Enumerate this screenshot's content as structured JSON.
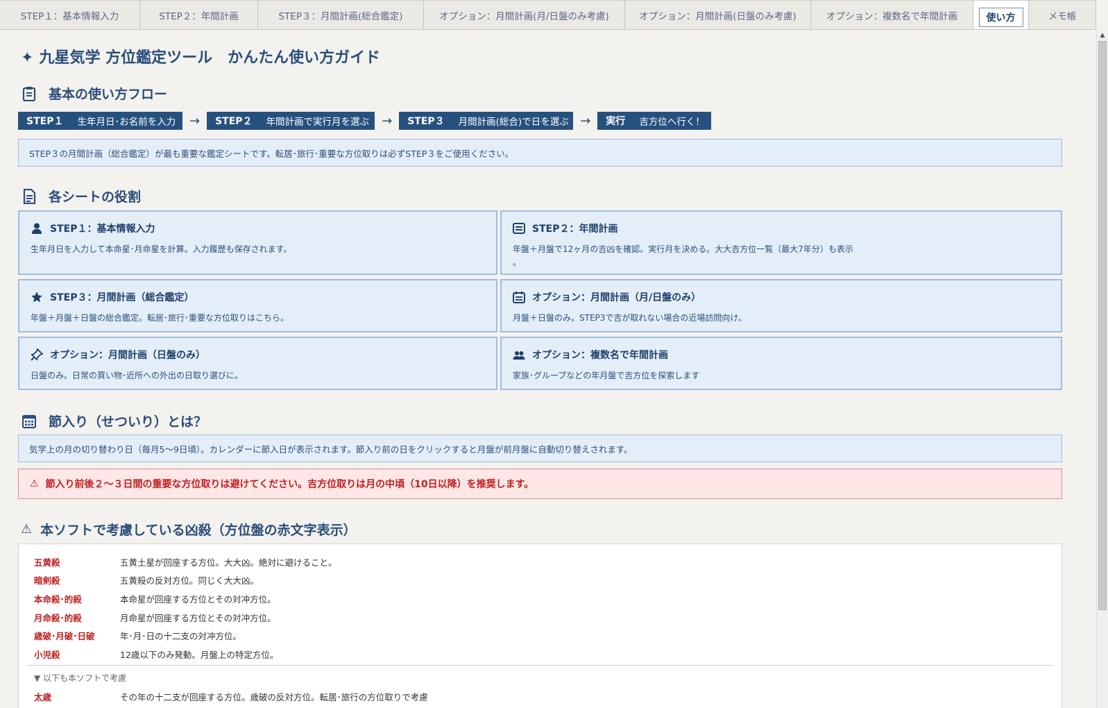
{
  "tabs": [
    {
      "label": "STEP１：基本情報入力",
      "active": false
    },
    {
      "label": "STEP２：年間計画",
      "active": false
    },
    {
      "label": "STEP３：月間計画(総合鑑定)",
      "active": false
    },
    {
      "label": "オプション：月間計画(月/日盤のみ考慮)",
      "active": false
    },
    {
      "label": "オプション：月間計画(日盤のみ考慮)",
      "active": false
    },
    {
      "label": "オプション：複数名で年間計画",
      "active": false
    },
    {
      "label": "使い方",
      "active": true
    },
    {
      "label": "メモ帳",
      "active": false
    }
  ],
  "page": {
    "title_icon": "✦",
    "title": "九星気学 方位鑑定ツール　かんたん使い方ガイド"
  },
  "flow_section": {
    "title": "基本の使い方フロー",
    "steps": [
      {
        "tag": "STEP１",
        "text": "生年月日･お名前を入力"
      },
      {
        "tag": "STEP２",
        "text": "年間計画で実行月を選ぶ"
      },
      {
        "tag": "STEP３",
        "text": "月間計画(総合)で日を選ぶ"
      },
      {
        "tag": "実行",
        "text": "吉方位へ行く！"
      }
    ],
    "arrow": "→",
    "note": "STEP３の月間計画（総合鑑定）が最も重要な鑑定シートです。転居･旅行･重要な方位取りは必ずSTEP３をご使用ください。"
  },
  "sheets_section": {
    "title": "各シートの役割",
    "cards": [
      {
        "icon": "user-icon",
        "title": "STEP１：基本情報入力",
        "desc": "生年月日を入力して本命星･月命星を計算。入力履歴も保存されます。"
      },
      {
        "icon": "list-icon",
        "title": "STEP２：年間計画",
        "desc": "年盤＋月盤で12ヶ月の吉凶を確認。実行月を決める。大大吉方位一覧（最大7年分）も表示\n。"
      },
      {
        "icon": "star-icon",
        "title": "STEP３：月間計画（総合鑑定）",
        "desc": "年盤＋月盤＋日盤の総合鑑定。転居･旅行･重要な方位取りはこちら。"
      },
      {
        "icon": "calendar-icon",
        "title": "オプション：月間計画（月/日盤のみ）",
        "desc": "月盤＋日盤のみ。STEP3で吉が取れない場合の近場訪問向け。"
      },
      {
        "icon": "pin-icon",
        "title": "オプション：月間計画（日盤のみ）",
        "desc": "日盤のみ。日常の買い物･近所への外出の日取り選びに。"
      },
      {
        "icon": "group-icon",
        "title": "オプション：複数名で年間計画",
        "desc": "家族･グループなどの年月盤で吉方位を探索します"
      }
    ]
  },
  "setsuiri_section": {
    "title": "節入り（せついり）とは？",
    "note": "気学上の月の切り替わり日（毎月5～9日頃）。カレンダーに節入日が表示されます。節入り前の日をクリックすると月盤が前月盤に自動切り替えされます。",
    "warning_icon": "⚠",
    "warning": "節入り前後２～３日間の重要な方位取りは避けてください。吉方位取りは月の中頃（10日以降）を推奨します。"
  },
  "kyousatsu_section": {
    "title_icon": "⚠",
    "title": "本ソフトで考慮している凶殺（方位盤の赤文字表示）",
    "items": [
      {
        "name": "五黄殺",
        "desc": "五黄土星が回座する方位。大大凶。絶対に避けること。"
      },
      {
        "name": "暗剣殺",
        "desc": "五黄殺の反対方位。同じく大大凶。"
      },
      {
        "name": "本命殺･的殺",
        "desc": "本命星が回座する方位とその対冲方位。"
      },
      {
        "name": "月命殺･的殺",
        "desc": "月命星が回座する方位とその対冲方位。"
      },
      {
        "name": "歳破･月破･日破",
        "desc": "年･月･日の十二支の対冲方位。"
      },
      {
        "name": "小児殺",
        "desc": "12歳以下のみ発動。月盤上の特定方位。"
      }
    ],
    "more_label": "▼ 以下も本ソフトで考慮",
    "extra_item": {
      "name": "太歳",
      "desc": "その年の十二支が回座する方位。歳破の反対方位。転居･旅行の方位取りで考慮"
    }
  },
  "colors": {
    "accent": "#26517f",
    "info_bg": "#e3eef9",
    "warn_text": "#c02020"
  }
}
